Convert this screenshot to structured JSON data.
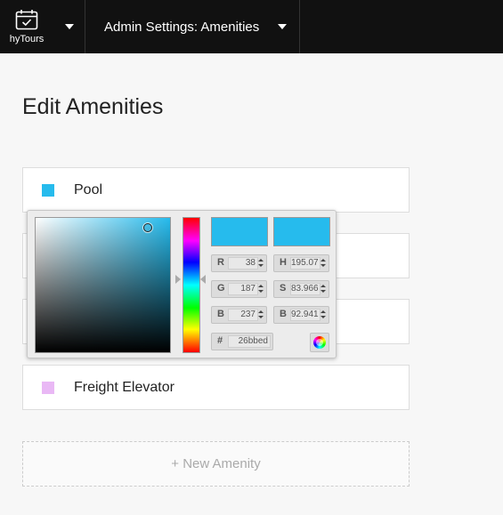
{
  "topbar": {
    "brand_label": "hyTours",
    "section_title": "Admin Settings: Amenities"
  },
  "page": {
    "title": "Edit Amenities"
  },
  "amenities": [
    {
      "name": "Pool",
      "color": "#26bbed"
    },
    {
      "name": "",
      "color": ""
    },
    {
      "name": "",
      "color": ""
    },
    {
      "name": "Freight Elevator",
      "color": "#e9b8f5"
    }
  ],
  "new_amenity_label": "+ New Amenity",
  "color_picker": {
    "hue_base": "#26bbed",
    "new_color": "#26bbed",
    "current_color": "#26bbed",
    "fields": {
      "r": {
        "label": "R",
        "value": "38"
      },
      "g": {
        "label": "G",
        "value": "187"
      },
      "b": {
        "label": "B",
        "value": "237"
      },
      "h": {
        "label": "H",
        "value": "195.07"
      },
      "s": {
        "label": "S",
        "value": "83.966"
      },
      "v": {
        "label": "B",
        "value": "92.941"
      },
      "hex": {
        "label": "#",
        "value": "26bbed"
      }
    }
  },
  "colors": {
    "topbar_bg": "#111111",
    "page_bg": "#f7f7f7"
  },
  "icons": {
    "brand": "calendar-check-icon",
    "wheel": "color-wheel-icon"
  }
}
